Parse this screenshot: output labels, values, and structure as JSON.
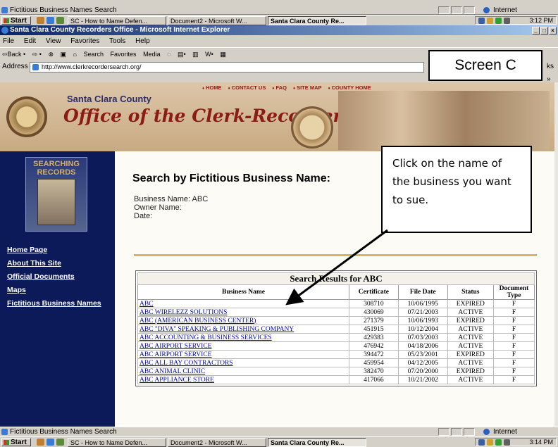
{
  "status_bar_top": {
    "text": "Fictitious Business Names Search",
    "zone": "Internet"
  },
  "taskbar_top": {
    "start": "Start",
    "buttons": [
      "SC - How to Name Defen...",
      "Document2 - Microsoft W...",
      "Santa Clara County Re..."
    ],
    "clock": "3:12 PM"
  },
  "window": {
    "title": "Santa Clara County Recorders Office - Microsoft Internet Explorer",
    "controls": [
      "_",
      "□",
      "×"
    ]
  },
  "menu": [
    "File",
    "Edit",
    "View",
    "Favorites",
    "Tools",
    "Help"
  ],
  "toolbar": [
    "⇦Back •",
    "⇨ •",
    "⊗",
    "▣",
    "⌂",
    "Search",
    "Favorites",
    "Media",
    "◌",
    "▤•",
    "▥",
    "W•",
    "▦"
  ],
  "address": {
    "label": "Address",
    "url": "http://www.clerkrecordersearch.org/",
    "links": "ks »"
  },
  "screen_label": "Screen C",
  "header": {
    "nav": [
      "HOME",
      "CONTACT US",
      "FAQ",
      "SITE MAP",
      "COUNTY HOME"
    ],
    "county": "Santa Clara County",
    "office": "Office of the Clerk-Recorder"
  },
  "sidebar": {
    "image_text": "SEARCHING RECORDS",
    "links": [
      "Home Page",
      "About This Site",
      "Official Documents",
      "Maps",
      "Fictitious Business Names"
    ]
  },
  "content": {
    "title": "Search by Fictitious Business Name:",
    "criteria": [
      "Business Name: ABC",
      "Owner Name:",
      "Date:"
    ]
  },
  "callout": "Click on the name of the business you want to sue.",
  "results": {
    "caption": "Search Results for ABC",
    "headers": [
      "Business Name",
      "Certificate",
      "File Date",
      "Status",
      "Document Type"
    ],
    "rows": [
      [
        "ABC",
        "308710",
        "10/06/1995",
        "EXPIRED",
        "F"
      ],
      [
        "ABC WIRELEZZ SOLUTIONS",
        "430069",
        "07/21/2003",
        "ACTIVE",
        "F"
      ],
      [
        "ABC (AMERICAN BUSINESS CENTER)",
        "271379",
        "10/06/1993",
        "EXPIRED",
        "F"
      ],
      [
        "ABC \"DIVA\" SPEAKING & PUBLISHING COMPANY",
        "451915",
        "10/12/2004",
        "ACTIVE",
        "F"
      ],
      [
        "ABC ACCOUNTING & BUSINESS SERVICES",
        "429383",
        "07/03/2003",
        "ACTIVE",
        "F"
      ],
      [
        "ABC AIRPORT SERVICE",
        "476942",
        "04/18/2006",
        "ACTIVE",
        "F"
      ],
      [
        "ABC AIRPORT SERVICE",
        "394472",
        "05/23/2001",
        "EXPIRED",
        "F"
      ],
      [
        "ABC ALL BAY CONTRACTORS",
        "459954",
        "04/12/2005",
        "ACTIVE",
        "F"
      ],
      [
        "ABC ANIMAL CLINIC",
        "382470",
        "07/20/2000",
        "EXPIRED",
        "F"
      ],
      [
        "ABC APPLIANCE STORE",
        "417066",
        "10/21/2002",
        "ACTIVE",
        "F"
      ]
    ]
  },
  "status_bar_bottom": {
    "text": "Fictitious Business Names Search",
    "zone": "Internet"
  },
  "taskbar_bottom": {
    "start": "Start",
    "buttons": [
      "SC - How to Name Defen...",
      "Document2 - Microsoft W...",
      "Santa Clara County Re..."
    ],
    "clock": "3:14 PM"
  }
}
